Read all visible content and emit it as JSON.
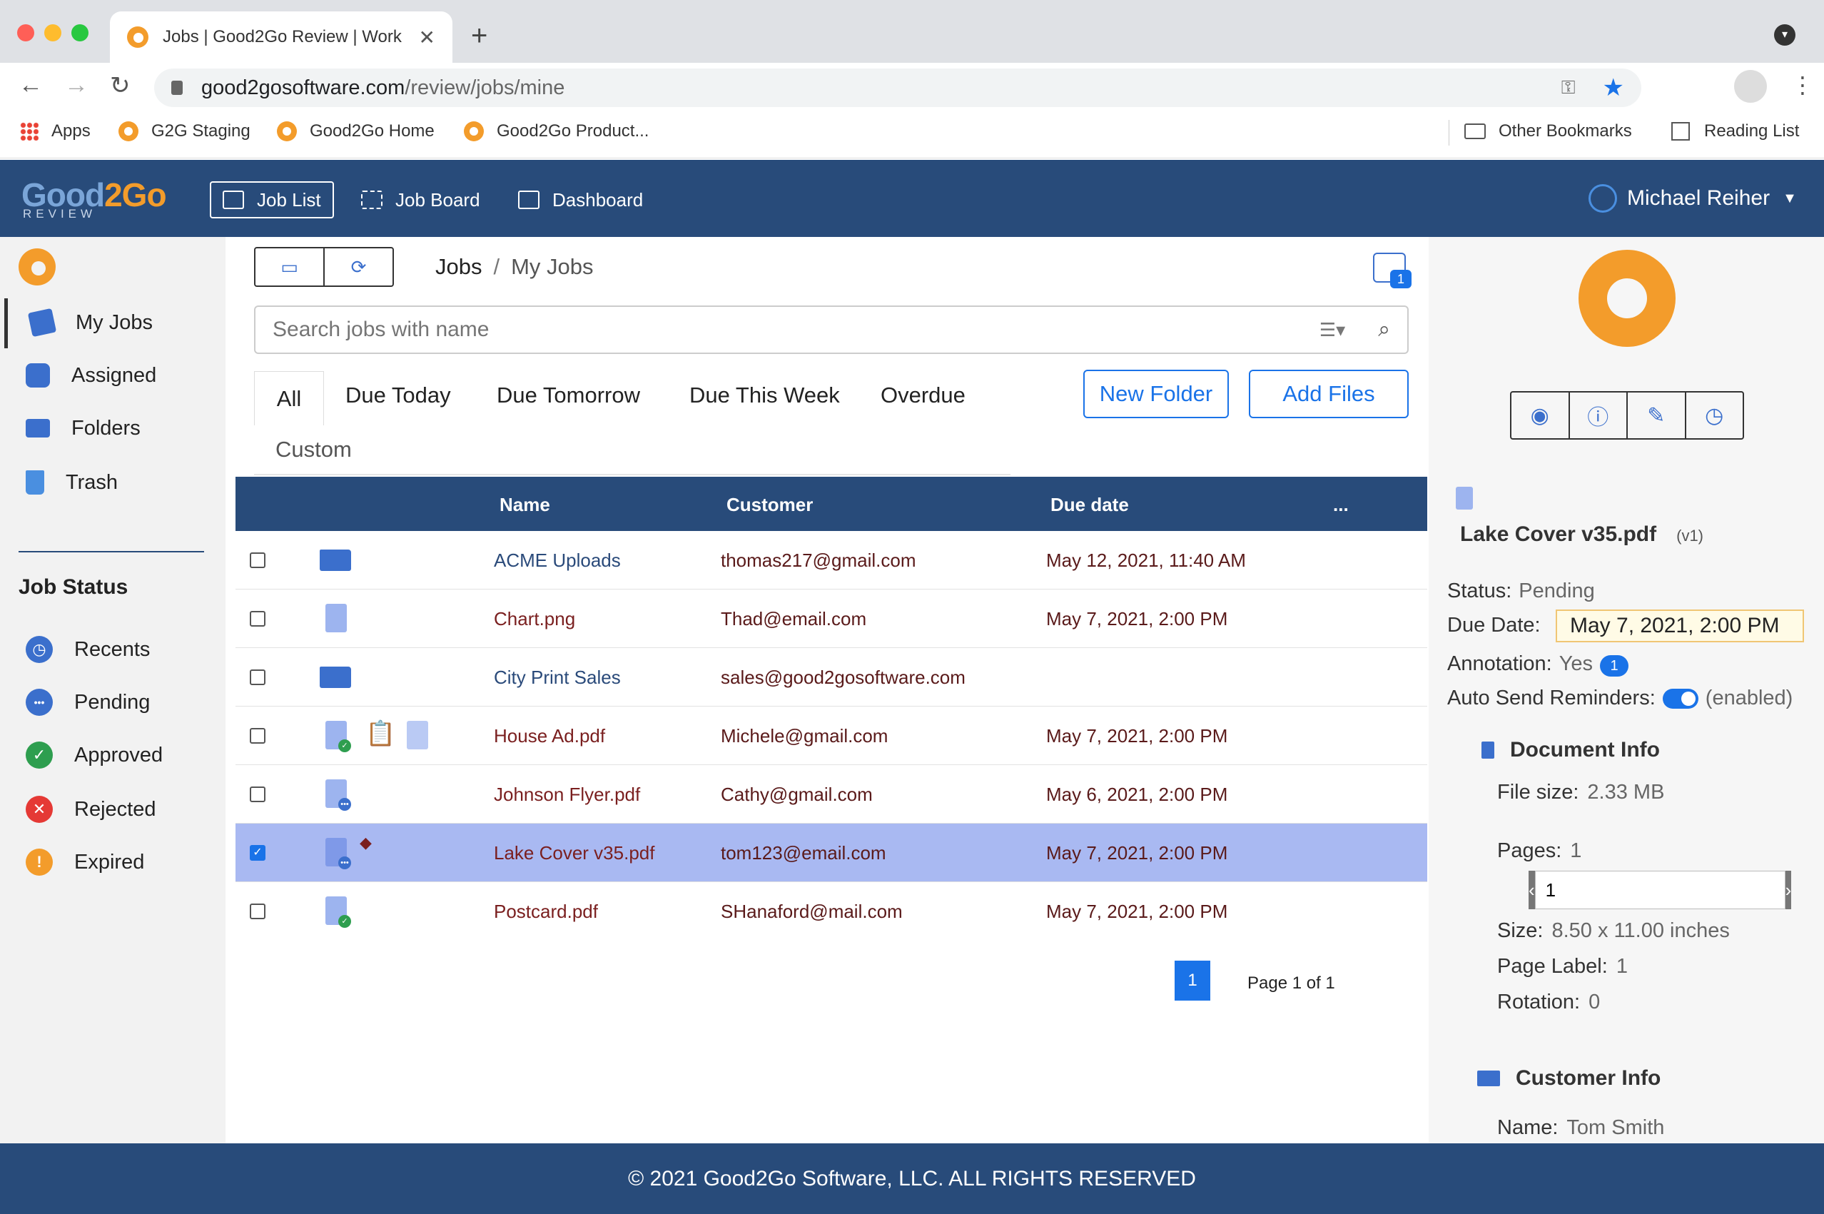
{
  "browser": {
    "tab_title": "Jobs | Good2Go Review | Work",
    "url_host": "good2gosoftware.com",
    "url_path": "/review/jobs/mine",
    "bookmarks": [
      "Apps",
      "G2G Staging",
      "Good2Go Home",
      "Good2Go Product..."
    ],
    "other_bookmarks": "Other Bookmarks",
    "reading_list": "Reading List"
  },
  "header": {
    "logo_text_a": "Good",
    "logo_text_b": "2Go",
    "logo_sub": "REVIEW",
    "nav": [
      {
        "label": "Job List",
        "icon": "list-icon",
        "active": true
      },
      {
        "label": "Job Board",
        "icon": "grid-icon",
        "active": false
      },
      {
        "label": "Dashboard",
        "icon": "dashboard-icon",
        "active": false
      }
    ],
    "user_name": "Michael Reiher"
  },
  "sidebar": {
    "items": [
      {
        "label": "My Jobs",
        "icon": "my-jobs-icon"
      },
      {
        "label": "Assigned",
        "icon": "assigned-icon"
      },
      {
        "label": "Folders",
        "icon": "folder-icon"
      },
      {
        "label": "Trash",
        "icon": "trash-icon"
      }
    ],
    "status_heading": "Job Status",
    "statuses": [
      {
        "label": "Recents",
        "icon": "clock-icon",
        "color": "#3b6fcc",
        "glyph": "◷"
      },
      {
        "label": "Pending",
        "icon": "pending-icon",
        "color": "#3b6fcc",
        "glyph": "•••"
      },
      {
        "label": "Approved",
        "icon": "check-icon",
        "color": "#2e9e4f",
        "glyph": "✓"
      },
      {
        "label": "Rejected",
        "icon": "x-icon",
        "color": "#e53935",
        "glyph": "✕"
      },
      {
        "label": "Expired",
        "icon": "alert-icon",
        "color": "#f39c2b",
        "glyph": "!"
      }
    ]
  },
  "main": {
    "breadcrumb_root": "Jobs",
    "breadcrumb_sep": "/",
    "breadcrumb_current": "My Jobs",
    "notif_count": "1",
    "search_placeholder": "Search jobs with name",
    "filter_tabs": [
      "All",
      "Due Today",
      "Due Tomorrow",
      "Due This Week",
      "Overdue"
    ],
    "custom_tab": "Custom",
    "new_folder_label": "New Folder",
    "add_files_label": "Add Files",
    "columns": {
      "name": "Name",
      "customer": "Customer",
      "due": "Due date",
      "more": "..."
    },
    "rows": [
      {
        "name": "ACME Uploads",
        "customer": "thomas217@gmail.com",
        "due": "May 12, 2021, 11:40 AM",
        "type": "folder",
        "selected": false
      },
      {
        "name": "Chart.png",
        "customer": "Thad@email.com",
        "due": "May 7, 2021, 2:00 PM",
        "type": "doc",
        "selected": false
      },
      {
        "name": "City Print Sales",
        "customer": "sales@good2gosoftware.com",
        "due": "",
        "type": "folder",
        "selected": false
      },
      {
        "name": "House Ad.pdf",
        "customer": "Michele@gmail.com",
        "due": "May 7, 2021, 2:00 PM",
        "type": "doc-approved",
        "selected": false
      },
      {
        "name": "Johnson Flyer.pdf",
        "customer": "Cathy@gmail.com",
        "due": "May 6, 2021, 2:00 PM",
        "type": "doc-pending",
        "selected": false
      },
      {
        "name": "Lake Cover v35.pdf",
        "customer": "tom123@email.com",
        "due": "May 7, 2021, 2:00 PM",
        "type": "doc-pending",
        "selected": true
      },
      {
        "name": "Postcard.pdf",
        "customer": "SHanaford@mail.com",
        "due": "May 7, 2021, 2:00 PM",
        "type": "doc-approved",
        "selected": false
      }
    ],
    "page_number": "1",
    "page_text": "Page 1 of 1"
  },
  "detail": {
    "file_name": "Lake Cover v35.pdf",
    "version": "(v1)",
    "status_label": "Status:",
    "status_value": "Pending",
    "due_label": "Due Date:",
    "due_value": "May 7, 2021, 2:00 PM",
    "annotation_label": "Annotation:",
    "annotation_value": "Yes",
    "annotation_count": "1",
    "reminders_label": "Auto Send Reminders:",
    "reminders_value": "(enabled)",
    "doc_info_heading": "Document Info",
    "file_size_label": "File size:",
    "file_size_value": "2.33 MB",
    "pages_label": "Pages:",
    "pages_value": "1",
    "page_input_value": "1",
    "size_label": "Size:",
    "size_value": "8.50 x 11.00 inches",
    "page_label_label": "Page Label:",
    "page_label_value": "1",
    "rotation_label": "Rotation:",
    "rotation_value": "0",
    "customer_info_heading": "Customer Info",
    "name_label": "Name:",
    "name_value": "Tom Smith"
  },
  "footer": {
    "text": "© 2021 Good2Go Software, LLC. ALL RIGHTS RESERVED"
  }
}
